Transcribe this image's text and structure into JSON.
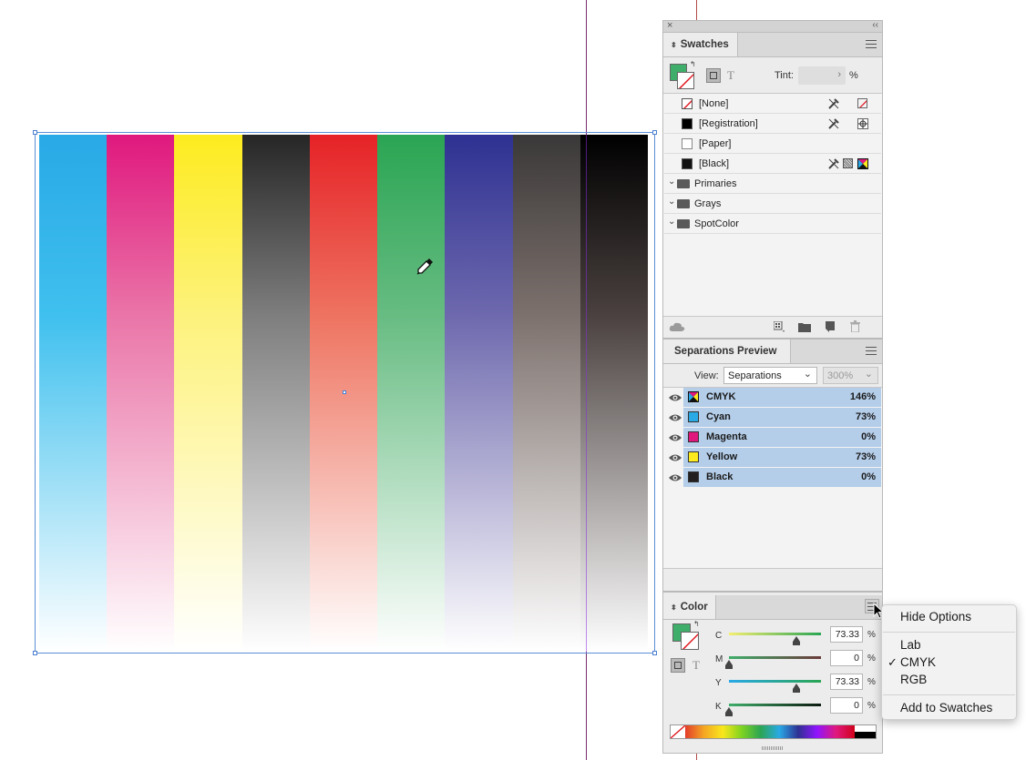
{
  "canvas": {
    "guide_color": "#7a2c6e",
    "frame_color": "#5a8fd6",
    "bars": [
      {
        "name": "cyan",
        "top": "#29a9e6",
        "mid": "#3fc0ee",
        "bottom": "#ffffff"
      },
      {
        "name": "magenta",
        "top": "#e0187e",
        "mid": "#ea75a8",
        "bottom": "#ffffff"
      },
      {
        "name": "yellow",
        "top": "#fdeb1f",
        "mid": "#fdf27c",
        "bottom": "#ffffff"
      },
      {
        "name": "dark-gray",
        "top": "#262626",
        "mid": "#7e7e7e",
        "bottom": "#ffffff"
      },
      {
        "name": "red",
        "top": "#e62227",
        "mid": "#ee7360",
        "bottom": "#ffffff"
      },
      {
        "name": "green",
        "top": "#2aa553",
        "mid": "#67bc82",
        "bottom": "#ffffff"
      },
      {
        "name": "blue",
        "top": "#2e3192",
        "mid": "#6e69ae",
        "bottom": "#ffffff"
      },
      {
        "name": "brown",
        "top": "#3a3838",
        "mid": "#7d716d",
        "bottom": "#ffffff"
      },
      {
        "name": "black",
        "top": "#000000",
        "mid": "#4a4140",
        "bottom": "#ffffff"
      }
    ]
  },
  "swatches": {
    "tab_label": "Swatches",
    "tint_label": "Tint:",
    "tint_value": "",
    "tint_unit": "%",
    "fill_color": "#3fae6a",
    "items": [
      {
        "label": "[None]",
        "chip": "none"
      },
      {
        "label": "[Registration]",
        "chip": "#000000"
      },
      {
        "label": "[Paper]",
        "chip": "#ffffff"
      },
      {
        "label": "[Black]",
        "chip": "#000000"
      }
    ],
    "groups": [
      {
        "label": "Primaries"
      },
      {
        "label": "Grays"
      },
      {
        "label": "SpotColor"
      }
    ]
  },
  "separations": {
    "tab_label": "Separations Preview",
    "view_label": "View:",
    "view_value": "Separations",
    "zoom_value": "300%",
    "rows": [
      {
        "name": "CMYK",
        "pct": "146%",
        "chip": "cmyk"
      },
      {
        "name": "Cyan",
        "pct": "73%",
        "chip": "#29a9e6"
      },
      {
        "name": "Magenta",
        "pct": "0%",
        "chip": "#e0187e"
      },
      {
        "name": "Yellow",
        "pct": "73%",
        "chip": "#fdeb1f"
      },
      {
        "name": "Black",
        "pct": "0%",
        "chip": "#231f20"
      }
    ]
  },
  "color": {
    "tab_label": "Color",
    "fill_color": "#3fae6a",
    "channels": [
      {
        "label": "C",
        "value": "73.33",
        "unit": "%",
        "level": 0.7333
      },
      {
        "label": "M",
        "value": "0",
        "unit": "%",
        "level": 0
      },
      {
        "label": "Y",
        "value": "73.33",
        "unit": "%",
        "level": 0.7333
      },
      {
        "label": "K",
        "value": "0",
        "unit": "%",
        "level": 0
      }
    ]
  },
  "context_menu": {
    "hide_options": "Hide Options",
    "lab": "Lab",
    "cmyk": "CMYK",
    "check": "✓",
    "rgb": "RGB",
    "add_to_swatches": "Add to Swatches"
  }
}
